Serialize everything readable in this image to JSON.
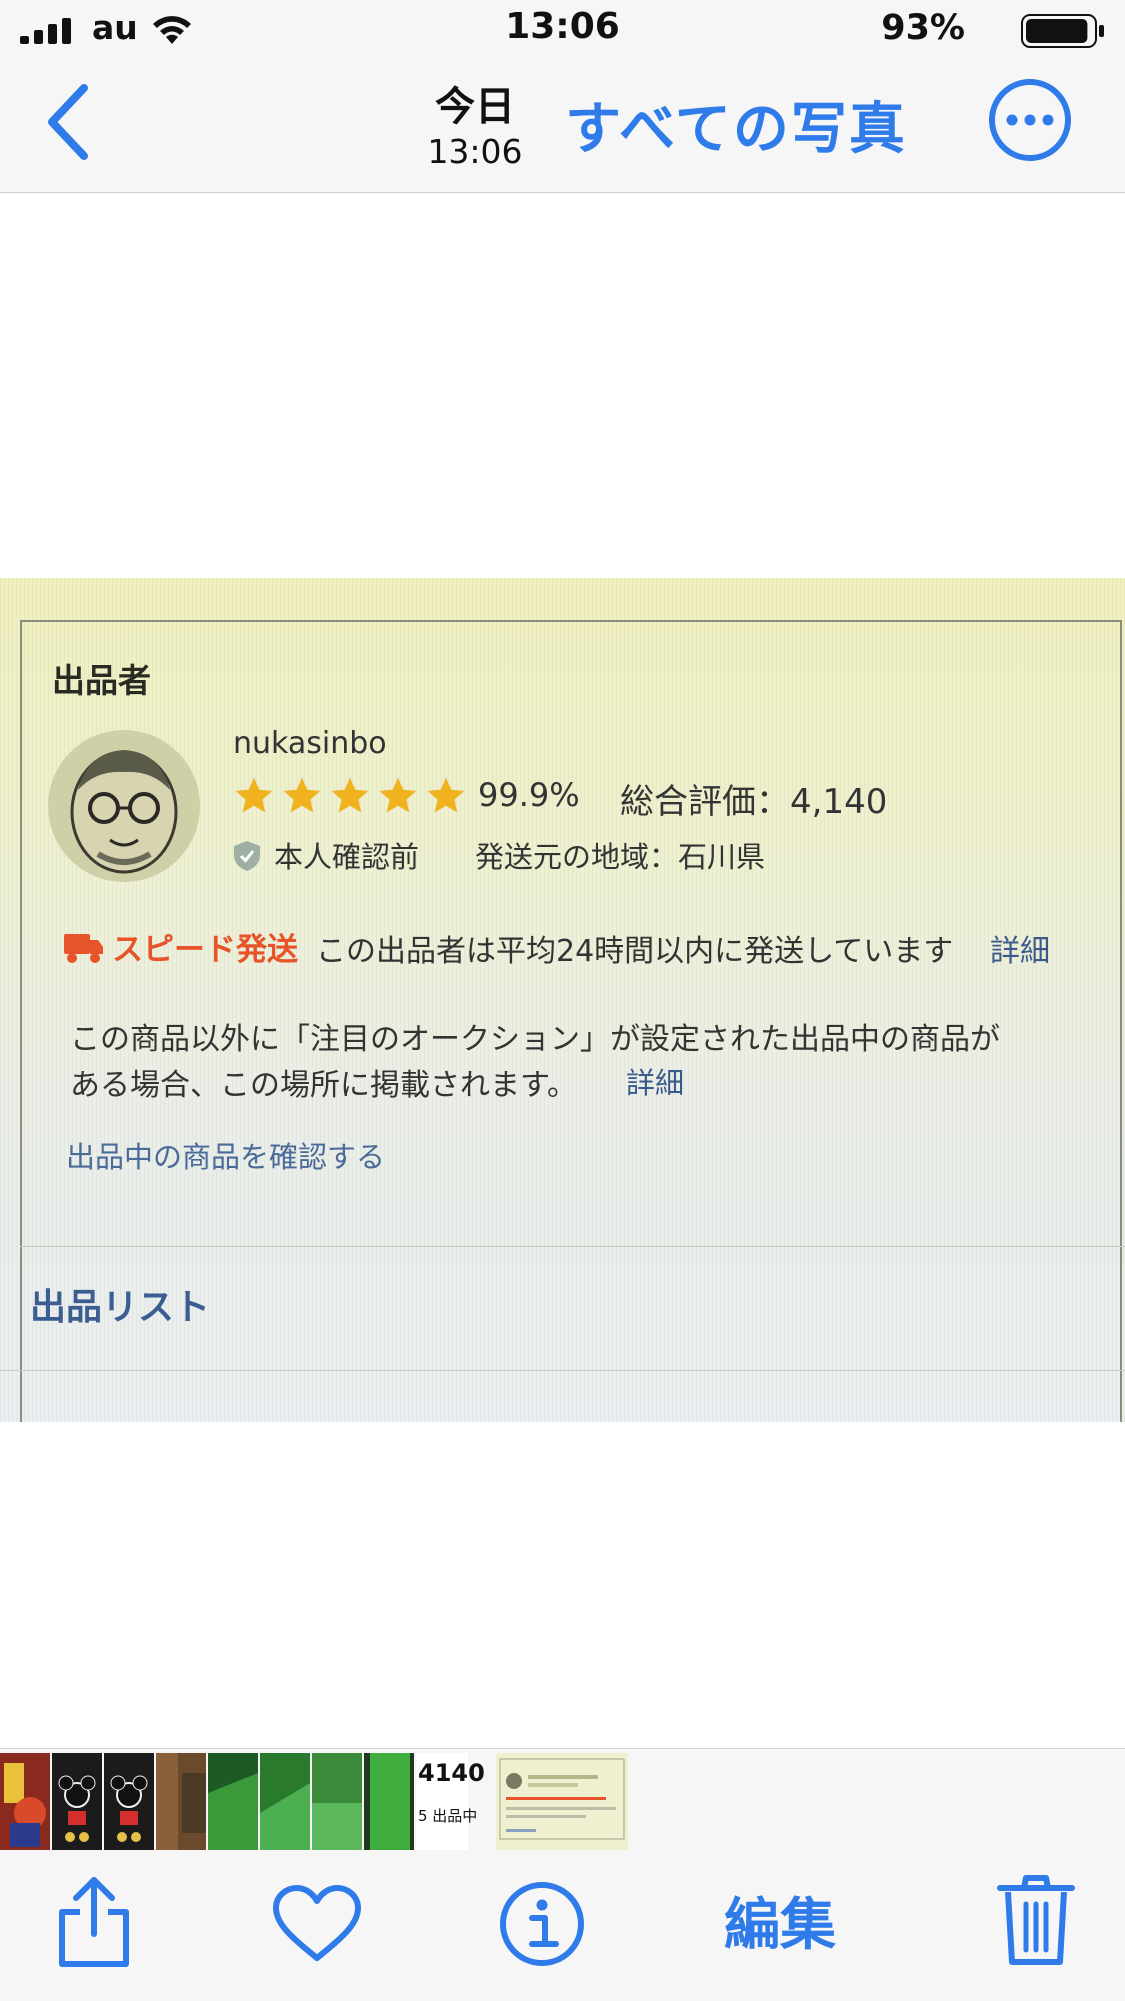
{
  "status_bar": {
    "carrier": "au",
    "time": "13:06",
    "battery_percent": "93%",
    "battery_level": 0.93
  },
  "nav": {
    "date": "今日",
    "time": "13:06",
    "all_photos": "すべての写真",
    "accent_color": "#2f7bea"
  },
  "photo": {
    "seller_heading": "出品者",
    "username": "nukasinbo",
    "star_rating": 5,
    "rating_percent": "99.9%",
    "total_rating": "総合評価：4,140",
    "verification": "本人確認前",
    "shipping_region": "発送元の地域：石川県",
    "speed_label": "スピード発送",
    "speed_desc": "この出品者は平均24時間以内に発送しています",
    "detail_link": "詳細",
    "notice_line1": "この商品以外に「注目のオークション」が設定された出品中の商品が",
    "notice_line2": "ある場合、この場所に掲載されます。",
    "detail_link_2": "詳細",
    "check_listings": "出品中の商品を確認する",
    "list_heading": "出品リスト"
  },
  "thumbnails": {
    "text_top": "4140",
    "text_bottom": "5 出品中"
  },
  "toolbar": {
    "edit_label": "編集"
  }
}
